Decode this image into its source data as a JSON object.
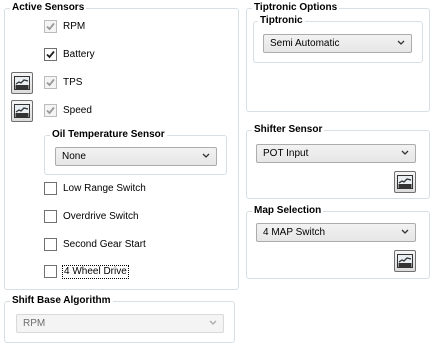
{
  "active_sensors": {
    "title": "Active Sensors",
    "items": [
      {
        "label": "RPM",
        "checked": true,
        "disabled": true
      },
      {
        "label": "Battery",
        "checked": true,
        "disabled": false
      },
      {
        "label": "TPS",
        "checked": true,
        "disabled": true
      },
      {
        "label": "Speed",
        "checked": true,
        "disabled": true
      },
      {
        "label": "Low Range Switch",
        "checked": false,
        "disabled": false
      },
      {
        "label": "Overdrive Switch",
        "checked": false,
        "disabled": false
      },
      {
        "label": "Second Gear Start",
        "checked": false,
        "disabled": false
      },
      {
        "label": "4 Wheel Drive",
        "checked": false,
        "disabled": false
      }
    ],
    "oil_temperature": {
      "title": "Oil Temperature Sensor",
      "value": "None"
    }
  },
  "shift_base": {
    "title": "Shift Base Algorithm",
    "value": "RPM"
  },
  "tiptronic_options": {
    "title": "Tiptronic Options",
    "tiptronic": {
      "title": "Tiptronic",
      "value": "Semi Automatic"
    }
  },
  "shifter_sensor": {
    "title": "Shifter Sensor",
    "value": "POT Input"
  },
  "map_selection": {
    "title": "Map Selection",
    "value": "4 MAP Switch"
  },
  "icons": {
    "graph_button": "chart-icon",
    "checkmark": "checkmark-icon",
    "dropdown": "chevron-down-icon"
  }
}
